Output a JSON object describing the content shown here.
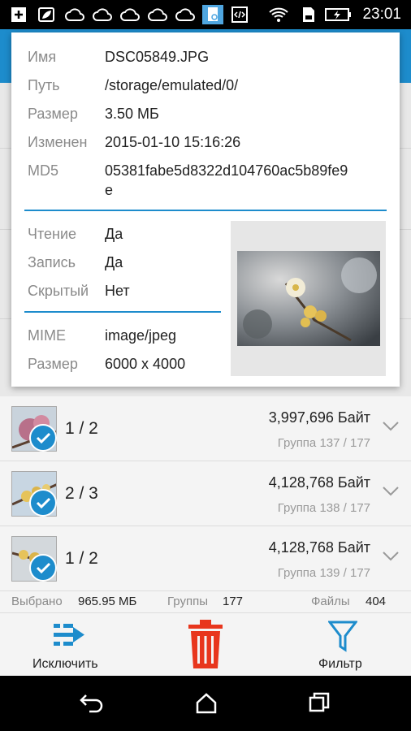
{
  "status_bar": {
    "time": "23:01",
    "icons": [
      "add-box-icon",
      "leaf-icon",
      "cloud-icon",
      "cloud-icon",
      "cloud-icon",
      "cloud-icon",
      "cloud-icon",
      "file-icon",
      "code-icon",
      "wifi-icon",
      "sd-card-icon",
      "battery-icon"
    ]
  },
  "details": {
    "name_label": "Имя",
    "name_value": "DSC05849.JPG",
    "path_label": "Путь",
    "path_value": "/storage/emulated/0/",
    "size_label": "Размер",
    "size_value": "3.50 МБ",
    "modified_label": "Изменен",
    "modified_value": "2015-01-10 15:16:26",
    "md5_label": "MD5",
    "md5_value_line1": "05381fabe5d8322d104760ac5b89fe9",
    "md5_value_line2": "e",
    "read_label": "Чтение",
    "read_value": "Да",
    "write_label": "Запись",
    "write_value": "Да",
    "hidden_label": "Скрытый",
    "hidden_value": "Нет",
    "mime_label": "MIME",
    "mime_value": "image/jpeg",
    "dimensions_label": "Размер",
    "dimensions_value": "6000 x 4000"
  },
  "items": [
    {
      "position": "1 / 2",
      "size": "3,997,696 Байт",
      "group": "Группа 137 / 177",
      "thumb": "pink-flower"
    },
    {
      "position": "2 / 3",
      "size": "4,128,768 Байт",
      "group": "Группа 138 / 177",
      "thumb": "yellow-flower"
    },
    {
      "position": "1 / 2",
      "size": "4,128,768 Байт",
      "group": "Группа 139 / 177",
      "thumb": "yellow-flower"
    }
  ],
  "summary": {
    "selected_label": "Выбрано",
    "selected_value": "965.95 МБ",
    "groups_label": "Группы",
    "groups_value": "177",
    "files_label": "Файлы",
    "files_value": "404"
  },
  "actions": {
    "exclude_label": "Исключить",
    "filter_label": "Фильтр"
  },
  "colors": {
    "accent": "#1d8ccc",
    "delete": "#e8361d",
    "exclude": "#1d8ccc"
  }
}
